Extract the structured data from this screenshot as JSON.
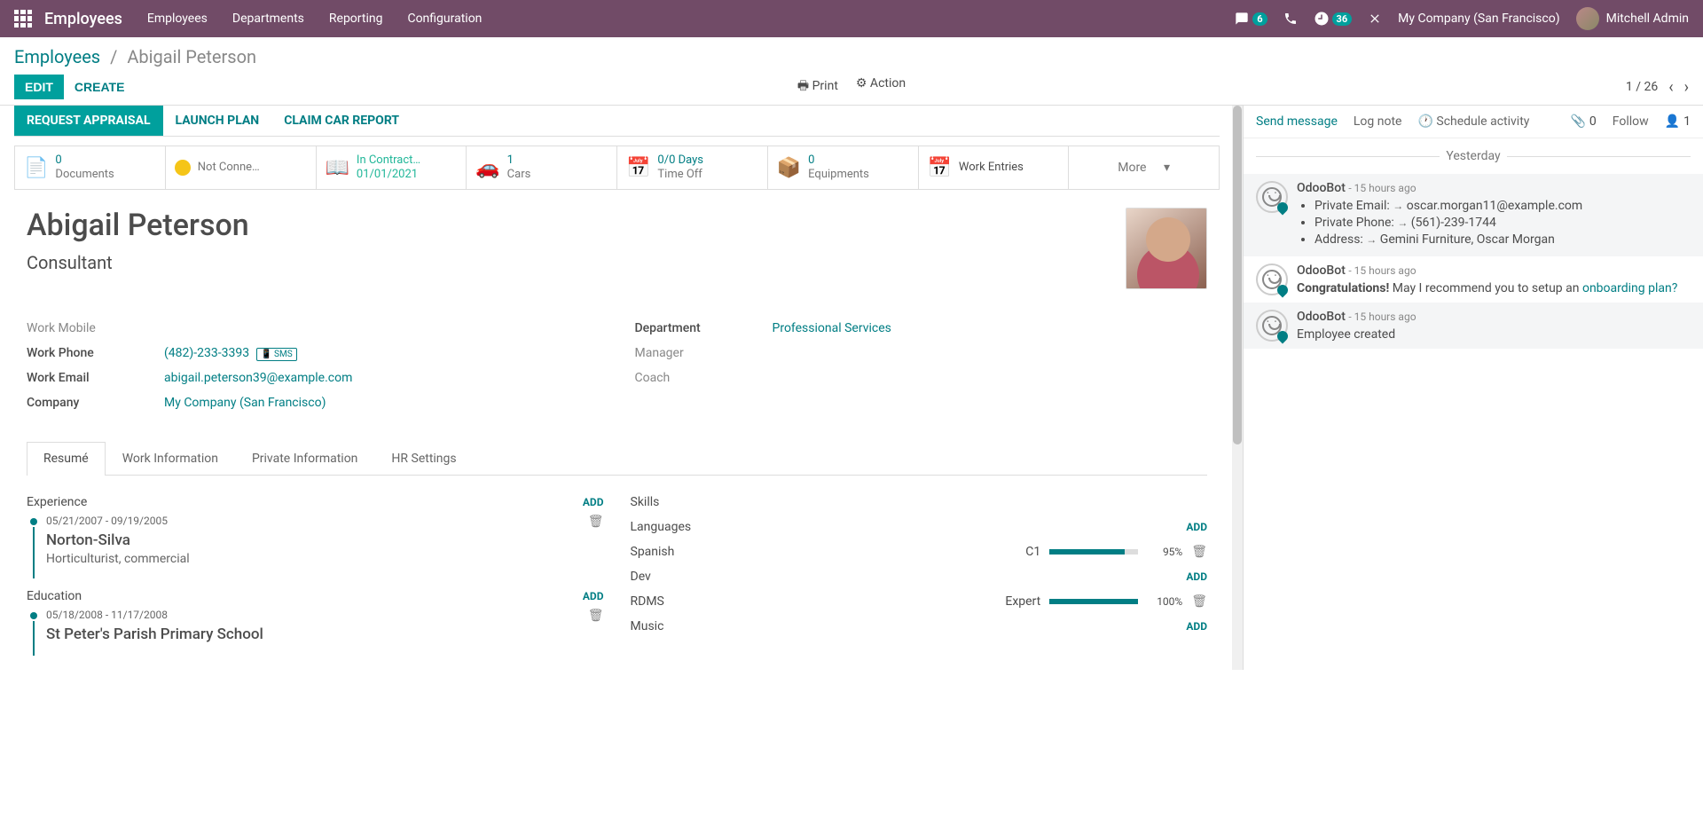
{
  "navbar": {
    "brand": "Employees",
    "menu": [
      "Employees",
      "Departments",
      "Reporting",
      "Configuration"
    ],
    "messages_badge": "6",
    "activities_badge": "36",
    "company": "My Company (San Francisco)",
    "user": "Mitchell Admin"
  },
  "breadcrumb": {
    "root": "Employees",
    "current": "Abigail Peterson"
  },
  "buttons": {
    "edit": "EDIT",
    "create": "CREATE",
    "print": "Print",
    "action": "Action"
  },
  "pager": {
    "text": "1 / 26"
  },
  "statusbar": {
    "request_appraisal": "REQUEST APPRAISAL",
    "launch_plan": "LAUNCH PLAN",
    "claim_car": "CLAIM CAR REPORT"
  },
  "stats": {
    "documents": {
      "val": "0",
      "lbl": "Documents"
    },
    "presence": {
      "lbl": "Not Conne…"
    },
    "contract": {
      "val": "In Contract…",
      "lbl": "01/01/2021"
    },
    "cars": {
      "val": "1",
      "lbl": "Cars"
    },
    "timeoff": {
      "val": "0/0 Days",
      "lbl": "Time Off"
    },
    "equip": {
      "val": "0",
      "lbl": "Equipments"
    },
    "workentries": {
      "lbl": "Work Entries"
    },
    "more": "More"
  },
  "employee": {
    "name": "Abigail Peterson",
    "title": "Consultant"
  },
  "fields": {
    "work_mobile_label": "Work Mobile",
    "work_phone_label": "Work Phone",
    "work_phone": "(482)-233-3393",
    "sms": "SMS",
    "work_email_label": "Work Email",
    "work_email": "abigail.peterson39@example.com",
    "company_label": "Company",
    "company": "My Company (San Francisco)",
    "department_label": "Department",
    "department": "Professional Services",
    "manager_label": "Manager",
    "coach_label": "Coach"
  },
  "tabs": [
    "Resumé",
    "Work Information",
    "Private Information",
    "HR Settings"
  ],
  "resume": {
    "experience_label": "Experience",
    "education_label": "Education",
    "add": "ADD",
    "exp1": {
      "dates": "05/21/2007 - 09/19/2005",
      "title": "Norton-Silva",
      "sub": "Horticulturist, commercial"
    },
    "edu1": {
      "dates": "05/18/2008 - 11/17/2008",
      "title": "St Peter's Parish Primary School"
    }
  },
  "skills": {
    "header": "Skills",
    "languages": "Languages",
    "dev": "Dev",
    "music": "Music",
    "add": "ADD",
    "spanish": {
      "name": "Spanish",
      "level": "C1",
      "pct": "95%"
    },
    "rdms": {
      "name": "RDMS",
      "level": "Expert",
      "pct": "100%"
    }
  },
  "chatter": {
    "send": "Send message",
    "log": "Log note",
    "schedule": "Schedule activity",
    "attach_count": "0",
    "follow": "Follow",
    "followers": "1",
    "yesterday": "Yesterday",
    "msg1": {
      "author": "OdooBot",
      "time": "- 15 hours ago",
      "email_label": "Private Email:",
      "email": "oscar.morgan11@example.com",
      "phone_label": "Private Phone:",
      "phone": "(561)-239-1744",
      "address_label": "Address:",
      "address": "Gemini Furniture, Oscar Morgan"
    },
    "msg2": {
      "author": "OdooBot",
      "time": "- 15 hours ago",
      "congrats": "Congratulations!",
      "text": " May I recommend you to setup an ",
      "link": "onboarding plan?"
    },
    "msg3": {
      "author": "OdooBot",
      "time": "- 15 hours ago",
      "text": "Employee created"
    }
  }
}
